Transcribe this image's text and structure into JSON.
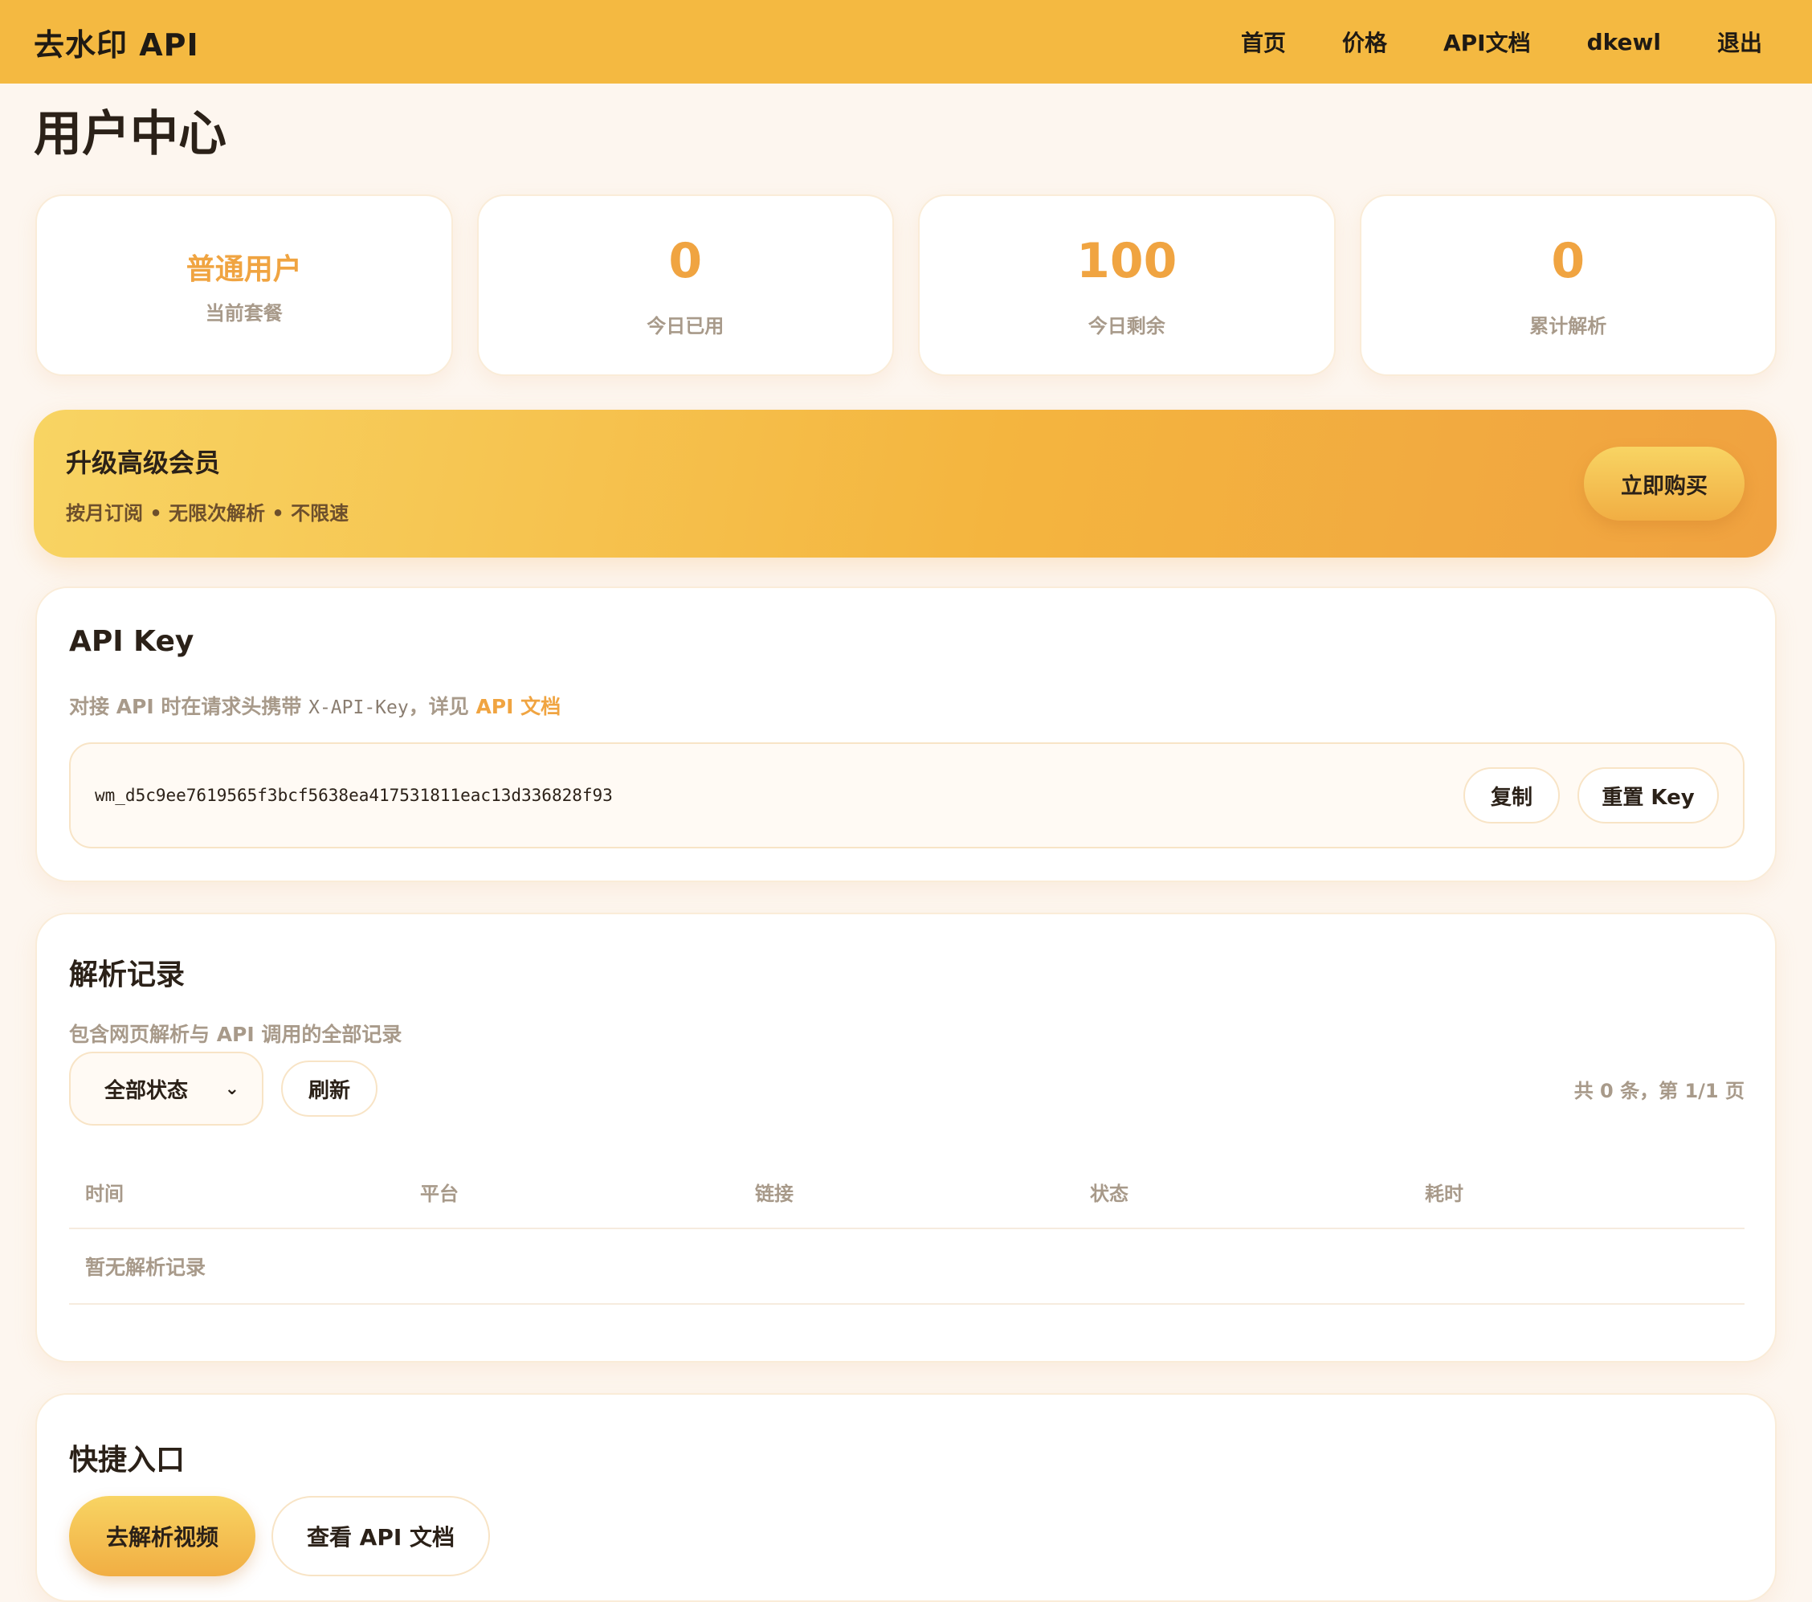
{
  "navbar": {
    "brand": "去水印 API",
    "links": [
      "首页",
      "价格",
      "API文档",
      "dkewl",
      "退出"
    ]
  },
  "page_title": "用户中心",
  "stats": {
    "plan": {
      "value": "普通用户",
      "label": "当前套餐"
    },
    "used_today": {
      "value": "0",
      "label": "今日已用"
    },
    "remaining_today": {
      "value": "100",
      "label": "今日剩余"
    },
    "total_parsed": {
      "value": "0",
      "label": "累计解析"
    }
  },
  "upgrade": {
    "title": "升级高级会员",
    "subtitle": "按月订阅 • 无限次解析 • 不限速",
    "button": "立即购买"
  },
  "api_key": {
    "title": "API Key",
    "hint_prefix": "对接 API 时在请求头携带 ",
    "hint_code": "X-API-Key",
    "hint_mid": "，详见 ",
    "hint_link": "API 文档",
    "key": "wm_d5c9ee7619565f3bcf5638ea417531811eac13d336828f93",
    "copy_label": "复制",
    "reset_label": "重置 Key"
  },
  "records": {
    "title": "解析记录",
    "subtitle": "包含网页解析与 API 调用的全部记录",
    "filter_selected": "全部状态",
    "refresh_label": "刷新",
    "page_info": "共 0 条，第 1/1 页",
    "columns": [
      "时间",
      "平台",
      "链接",
      "状态",
      "耗时"
    ],
    "empty_text": "暂无解析记录"
  },
  "quick": {
    "title": "快捷入口",
    "parse_label": "去解析视频",
    "docs_label": "查看 API 文档"
  }
}
